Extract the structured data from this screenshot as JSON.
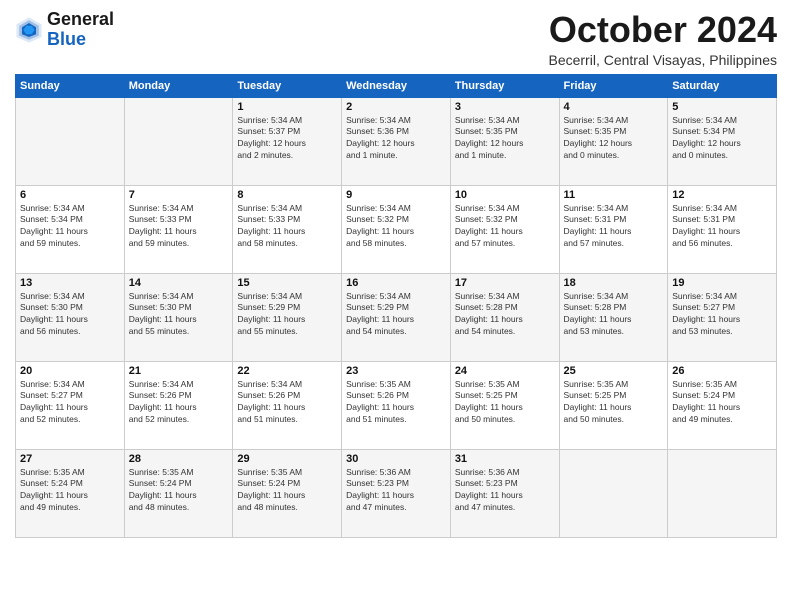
{
  "logo": {
    "line1": "General",
    "line2": "Blue"
  },
  "title": "October 2024",
  "location": "Becerril, Central Visayas, Philippines",
  "weekdays": [
    "Sunday",
    "Monday",
    "Tuesday",
    "Wednesday",
    "Thursday",
    "Friday",
    "Saturday"
  ],
  "weeks": [
    [
      {
        "day": "",
        "detail": ""
      },
      {
        "day": "",
        "detail": ""
      },
      {
        "day": "1",
        "detail": "Sunrise: 5:34 AM\nSunset: 5:37 PM\nDaylight: 12 hours\nand 2 minutes."
      },
      {
        "day": "2",
        "detail": "Sunrise: 5:34 AM\nSunset: 5:36 PM\nDaylight: 12 hours\nand 1 minute."
      },
      {
        "day": "3",
        "detail": "Sunrise: 5:34 AM\nSunset: 5:35 PM\nDaylight: 12 hours\nand 1 minute."
      },
      {
        "day": "4",
        "detail": "Sunrise: 5:34 AM\nSunset: 5:35 PM\nDaylight: 12 hours\nand 0 minutes."
      },
      {
        "day": "5",
        "detail": "Sunrise: 5:34 AM\nSunset: 5:34 PM\nDaylight: 12 hours\nand 0 minutes."
      }
    ],
    [
      {
        "day": "6",
        "detail": "Sunrise: 5:34 AM\nSunset: 5:34 PM\nDaylight: 11 hours\nand 59 minutes."
      },
      {
        "day": "7",
        "detail": "Sunrise: 5:34 AM\nSunset: 5:33 PM\nDaylight: 11 hours\nand 59 minutes."
      },
      {
        "day": "8",
        "detail": "Sunrise: 5:34 AM\nSunset: 5:33 PM\nDaylight: 11 hours\nand 58 minutes."
      },
      {
        "day": "9",
        "detail": "Sunrise: 5:34 AM\nSunset: 5:32 PM\nDaylight: 11 hours\nand 58 minutes."
      },
      {
        "day": "10",
        "detail": "Sunrise: 5:34 AM\nSunset: 5:32 PM\nDaylight: 11 hours\nand 57 minutes."
      },
      {
        "day": "11",
        "detail": "Sunrise: 5:34 AM\nSunset: 5:31 PM\nDaylight: 11 hours\nand 57 minutes."
      },
      {
        "day": "12",
        "detail": "Sunrise: 5:34 AM\nSunset: 5:31 PM\nDaylight: 11 hours\nand 56 minutes."
      }
    ],
    [
      {
        "day": "13",
        "detail": "Sunrise: 5:34 AM\nSunset: 5:30 PM\nDaylight: 11 hours\nand 56 minutes."
      },
      {
        "day": "14",
        "detail": "Sunrise: 5:34 AM\nSunset: 5:30 PM\nDaylight: 11 hours\nand 55 minutes."
      },
      {
        "day": "15",
        "detail": "Sunrise: 5:34 AM\nSunset: 5:29 PM\nDaylight: 11 hours\nand 55 minutes."
      },
      {
        "day": "16",
        "detail": "Sunrise: 5:34 AM\nSunset: 5:29 PM\nDaylight: 11 hours\nand 54 minutes."
      },
      {
        "day": "17",
        "detail": "Sunrise: 5:34 AM\nSunset: 5:28 PM\nDaylight: 11 hours\nand 54 minutes."
      },
      {
        "day": "18",
        "detail": "Sunrise: 5:34 AM\nSunset: 5:28 PM\nDaylight: 11 hours\nand 53 minutes."
      },
      {
        "day": "19",
        "detail": "Sunrise: 5:34 AM\nSunset: 5:27 PM\nDaylight: 11 hours\nand 53 minutes."
      }
    ],
    [
      {
        "day": "20",
        "detail": "Sunrise: 5:34 AM\nSunset: 5:27 PM\nDaylight: 11 hours\nand 52 minutes."
      },
      {
        "day": "21",
        "detail": "Sunrise: 5:34 AM\nSunset: 5:26 PM\nDaylight: 11 hours\nand 52 minutes."
      },
      {
        "day": "22",
        "detail": "Sunrise: 5:34 AM\nSunset: 5:26 PM\nDaylight: 11 hours\nand 51 minutes."
      },
      {
        "day": "23",
        "detail": "Sunrise: 5:35 AM\nSunset: 5:26 PM\nDaylight: 11 hours\nand 51 minutes."
      },
      {
        "day": "24",
        "detail": "Sunrise: 5:35 AM\nSunset: 5:25 PM\nDaylight: 11 hours\nand 50 minutes."
      },
      {
        "day": "25",
        "detail": "Sunrise: 5:35 AM\nSunset: 5:25 PM\nDaylight: 11 hours\nand 50 minutes."
      },
      {
        "day": "26",
        "detail": "Sunrise: 5:35 AM\nSunset: 5:24 PM\nDaylight: 11 hours\nand 49 minutes."
      }
    ],
    [
      {
        "day": "27",
        "detail": "Sunrise: 5:35 AM\nSunset: 5:24 PM\nDaylight: 11 hours\nand 49 minutes."
      },
      {
        "day": "28",
        "detail": "Sunrise: 5:35 AM\nSunset: 5:24 PM\nDaylight: 11 hours\nand 48 minutes."
      },
      {
        "day": "29",
        "detail": "Sunrise: 5:35 AM\nSunset: 5:24 PM\nDaylight: 11 hours\nand 48 minutes."
      },
      {
        "day": "30",
        "detail": "Sunrise: 5:36 AM\nSunset: 5:23 PM\nDaylight: 11 hours\nand 47 minutes."
      },
      {
        "day": "31",
        "detail": "Sunrise: 5:36 AM\nSunset: 5:23 PM\nDaylight: 11 hours\nand 47 minutes."
      },
      {
        "day": "",
        "detail": ""
      },
      {
        "day": "",
        "detail": ""
      }
    ]
  ]
}
